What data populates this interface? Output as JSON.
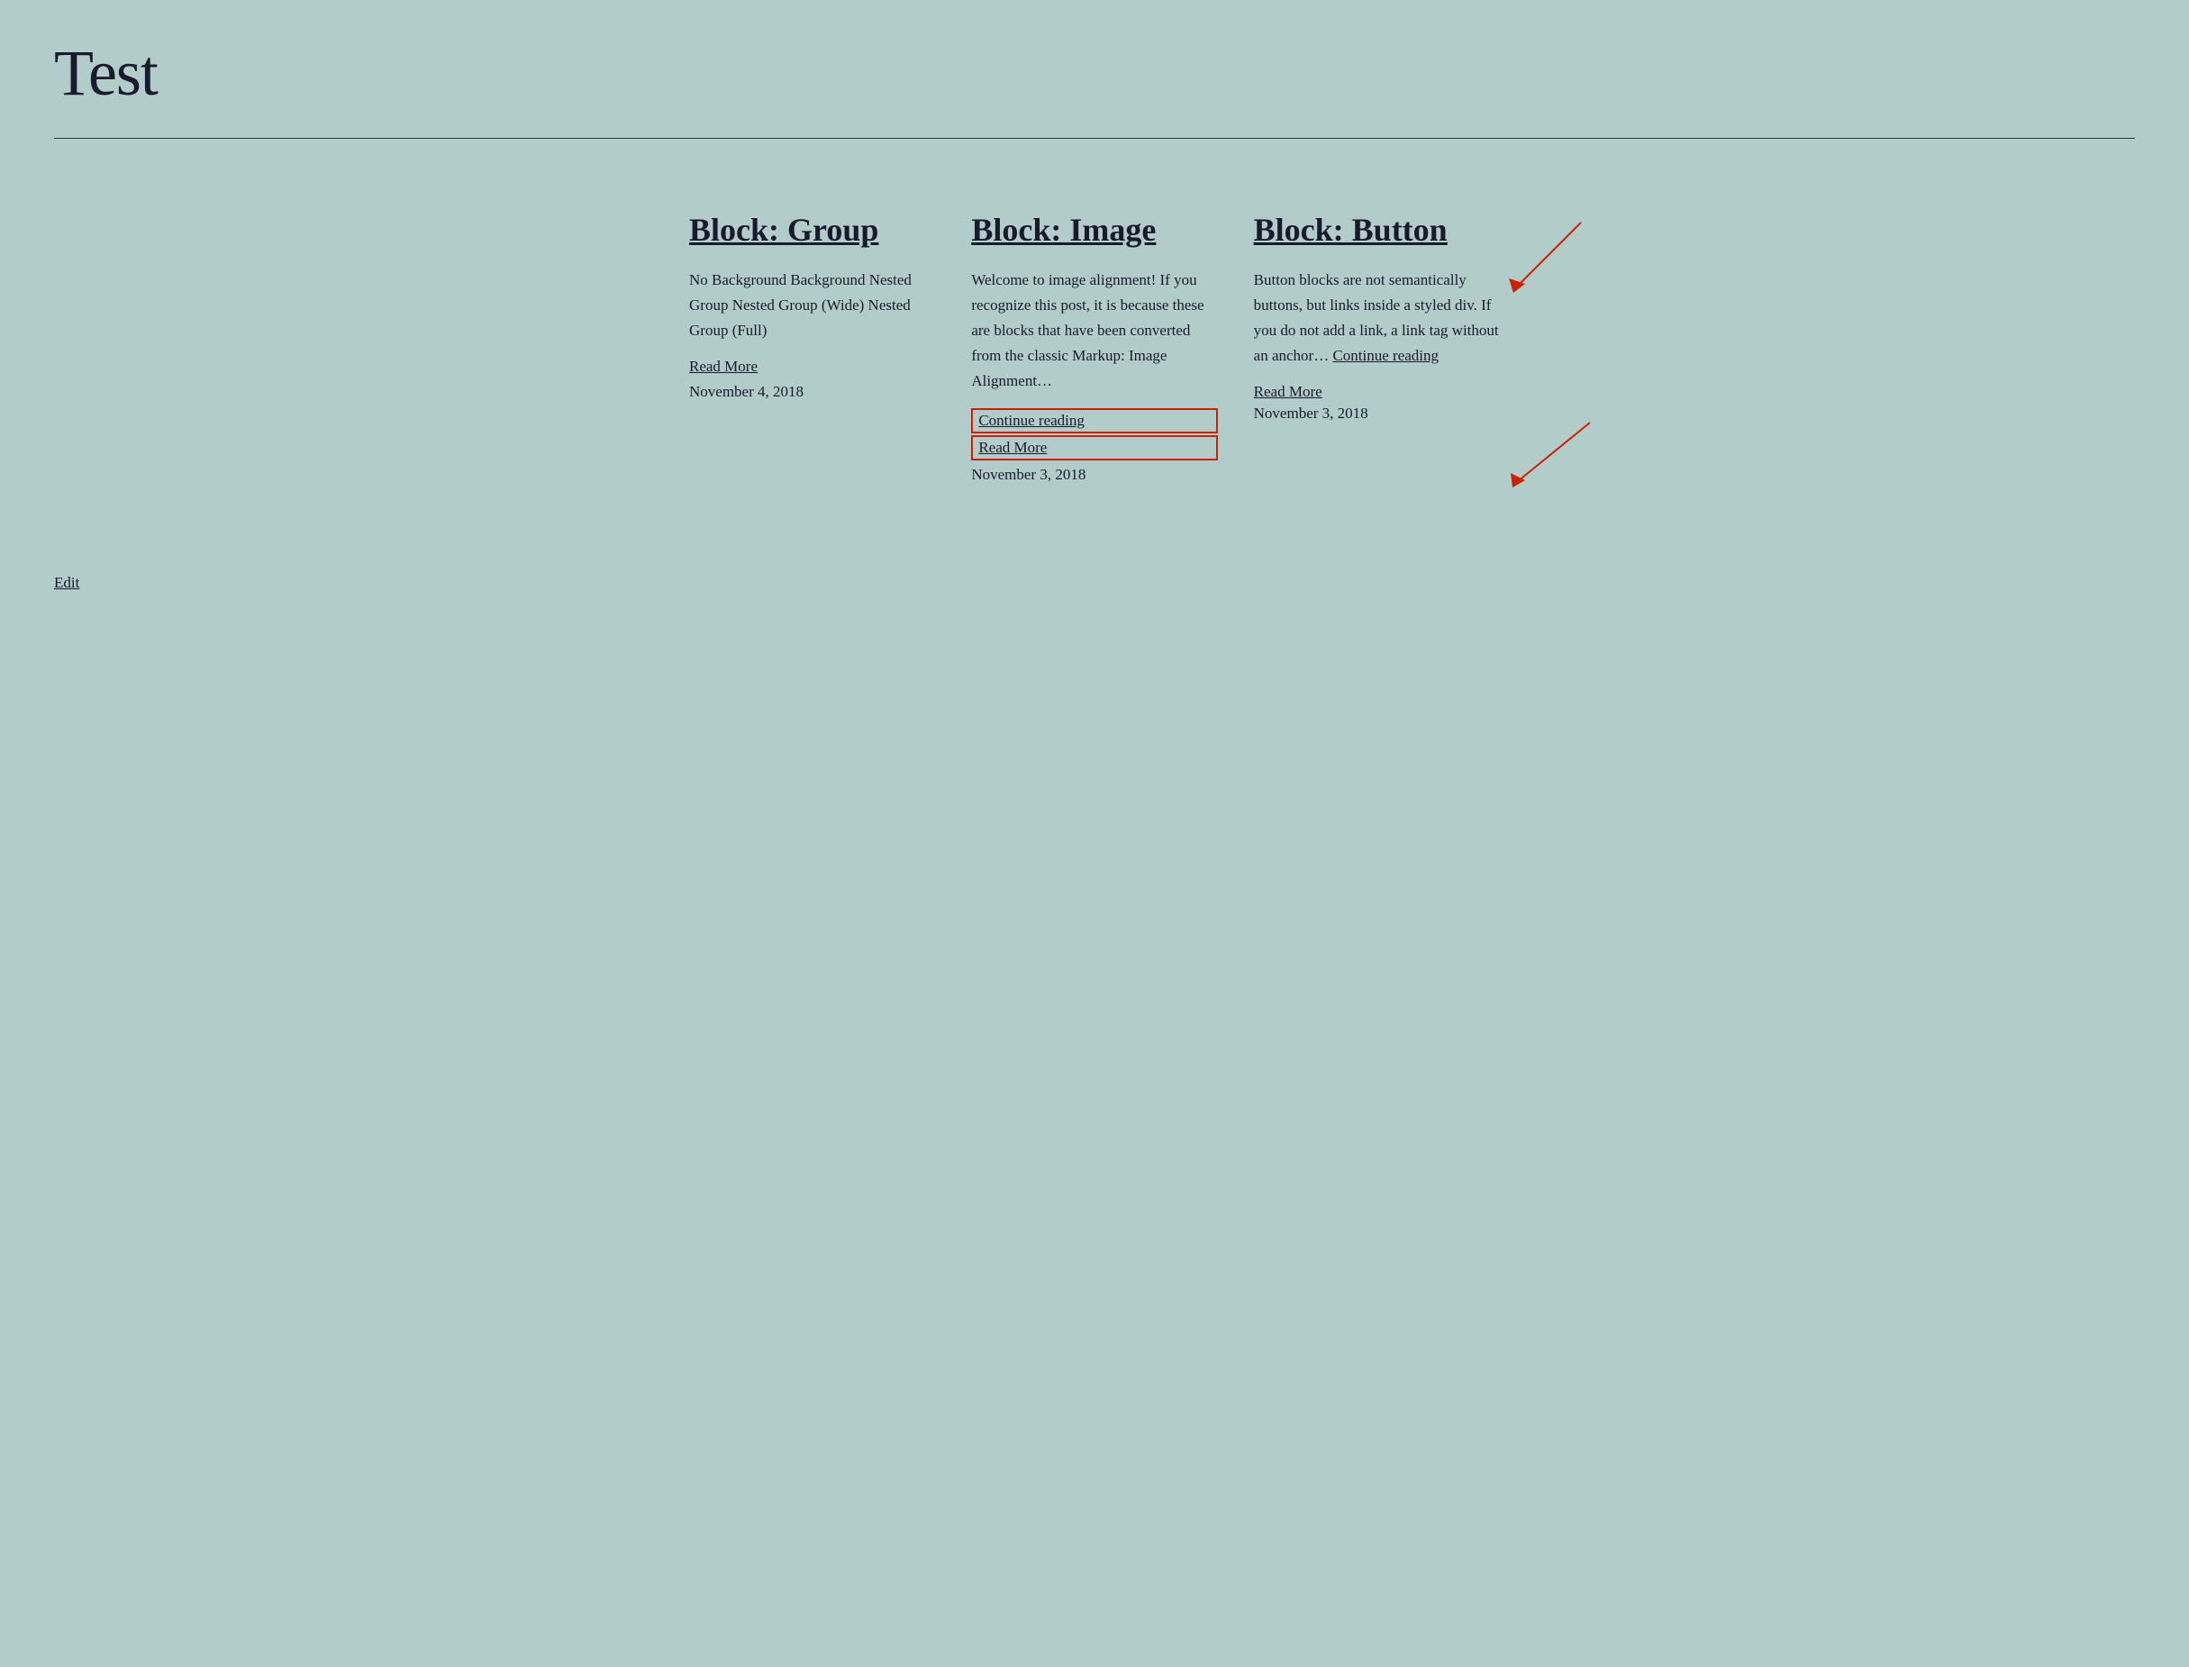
{
  "site": {
    "title": "Test"
  },
  "posts": [
    {
      "id": "post-1",
      "title": "Block: Group",
      "excerpt": "No Background Background Nested Group Nested Group (Wide) Nested Group (Full)",
      "read_more_label": "Read More",
      "date": "November 4, 2018",
      "has_continue_reading": false,
      "has_red_box": false
    },
    {
      "id": "post-2",
      "title": "Block: Image",
      "excerpt": "Welcome to image alignment! If you recognize this post, it is because these are blocks that have been converted from the classic Markup: Image Alignment…",
      "continue_reading_label": "Continue reading",
      "read_more_label": "Read More",
      "date": "November 3, 2018",
      "has_continue_reading": true,
      "has_red_box": true
    },
    {
      "id": "post-3",
      "title": "Block: Button",
      "excerpt": "Button blocks are not semantically buttons, but links inside a styled div.  If you do not add a link, a link tag without an anchor…",
      "continue_reading_label": "Continue reading",
      "read_more_label": "Read More",
      "date": "November 3, 2018",
      "has_continue_reading": true,
      "has_red_box": false
    }
  ],
  "footer": {
    "edit_label": "Edit"
  }
}
